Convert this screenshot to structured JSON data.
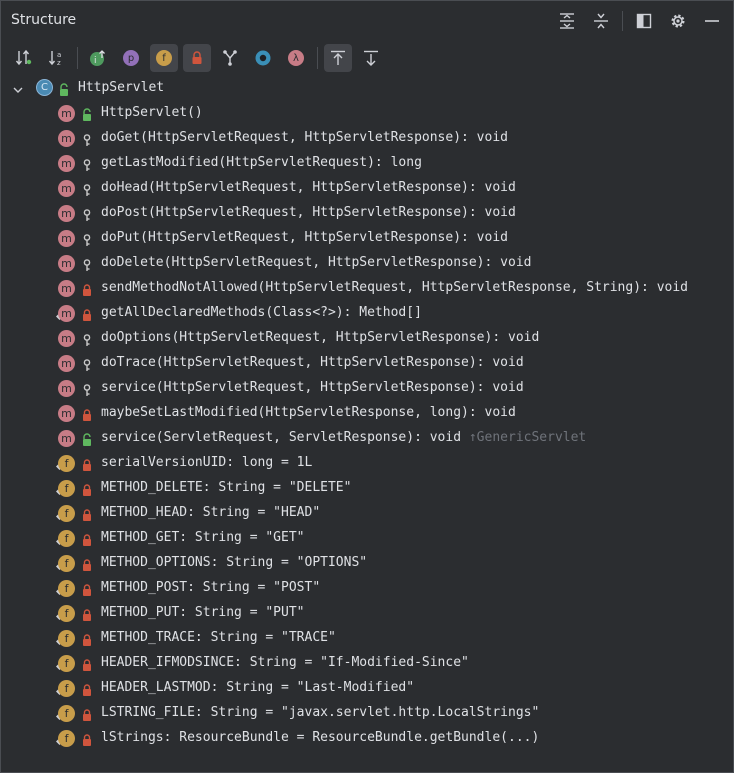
{
  "panel": {
    "title": "Structure"
  },
  "title_actions": [
    "expand-all-icon",
    "collapse-all-icon",
    "dock-icon",
    "gear-icon",
    "minimize-icon"
  ],
  "toolbar": {
    "buttons": [
      "sort-by-visibility",
      "sort-alphabetically",
      "show-inherited",
      "show-properties",
      "show-fields",
      "show-non-public",
      "show-lambdas",
      "anonymous-classes",
      "show-lambdas-2",
      "autoscroll-to-source",
      "autoscroll-from-source"
    ]
  },
  "root": {
    "label": "HttpServlet",
    "badge": "C"
  },
  "items": [
    {
      "kind": "m",
      "vis": "public",
      "text": "HttpServlet()"
    },
    {
      "kind": "m",
      "vis": "protected",
      "text": "doGet(HttpServletRequest, HttpServletResponse): void"
    },
    {
      "kind": "m",
      "vis": "protected",
      "text": "getLastModified(HttpServletRequest): long"
    },
    {
      "kind": "m",
      "vis": "protected",
      "text": "doHead(HttpServletRequest, HttpServletResponse): void"
    },
    {
      "kind": "m",
      "vis": "protected",
      "text": "doPost(HttpServletRequest, HttpServletResponse): void"
    },
    {
      "kind": "m",
      "vis": "protected",
      "text": "doPut(HttpServletRequest, HttpServletResponse): void"
    },
    {
      "kind": "m",
      "vis": "protected",
      "text": "doDelete(HttpServletRequest, HttpServletResponse): void"
    },
    {
      "kind": "m",
      "vis": "private",
      "text": "sendMethodNotAllowed(HttpServletRequest, HttpServletResponse, String): void"
    },
    {
      "kind": "m",
      "vis": "private",
      "text": "getAllDeclaredMethods(Class<?>): Method[]",
      "static": true
    },
    {
      "kind": "m",
      "vis": "protected",
      "text": "doOptions(HttpServletRequest, HttpServletResponse): void"
    },
    {
      "kind": "m",
      "vis": "protected",
      "text": "doTrace(HttpServletRequest, HttpServletResponse): void"
    },
    {
      "kind": "m",
      "vis": "protected",
      "text": "service(HttpServletRequest, HttpServletResponse): void"
    },
    {
      "kind": "m",
      "vis": "private",
      "text": "maybeSetLastModified(HttpServletResponse, long): void"
    },
    {
      "kind": "m",
      "vis": "public",
      "text": "service(ServletRequest, ServletResponse): void",
      "inherited": "↑GenericServlet"
    },
    {
      "kind": "f",
      "vis": "private",
      "text": "serialVersionUID: long = 1L",
      "static": true
    },
    {
      "kind": "f",
      "vis": "private",
      "text": "METHOD_DELETE: String = \"DELETE\"",
      "static": true
    },
    {
      "kind": "f",
      "vis": "private",
      "text": "METHOD_HEAD: String = \"HEAD\"",
      "static": true
    },
    {
      "kind": "f",
      "vis": "private",
      "text": "METHOD_GET: String = \"GET\"",
      "static": true
    },
    {
      "kind": "f",
      "vis": "private",
      "text": "METHOD_OPTIONS: String = \"OPTIONS\"",
      "static": true
    },
    {
      "kind": "f",
      "vis": "private",
      "text": "METHOD_POST: String = \"POST\"",
      "static": true
    },
    {
      "kind": "f",
      "vis": "private",
      "text": "METHOD_PUT: String = \"PUT\"",
      "static": true
    },
    {
      "kind": "f",
      "vis": "private",
      "text": "METHOD_TRACE: String = \"TRACE\"",
      "static": true
    },
    {
      "kind": "f",
      "vis": "private",
      "text": "HEADER_IFMODSINCE: String = \"If-Modified-Since\"",
      "static": true
    },
    {
      "kind": "f",
      "vis": "private",
      "text": "HEADER_LASTMOD: String = \"Last-Modified\"",
      "static": true
    },
    {
      "kind": "f",
      "vis": "private",
      "text": "LSTRING_FILE: String = \"javax.servlet.http.LocalStrings\"",
      "static": true
    },
    {
      "kind": "f",
      "vis": "private",
      "text": "lStrings: ResourceBundle = ResourceBundle.getBundle(...)",
      "static": true
    }
  ],
  "colors": {
    "background": "#2b2d30",
    "method_badge": "#c77c86",
    "field_badge": "#c89d4a",
    "public": "#5fb85f",
    "private": "#d0553d",
    "protected": "#c9c9c9"
  }
}
